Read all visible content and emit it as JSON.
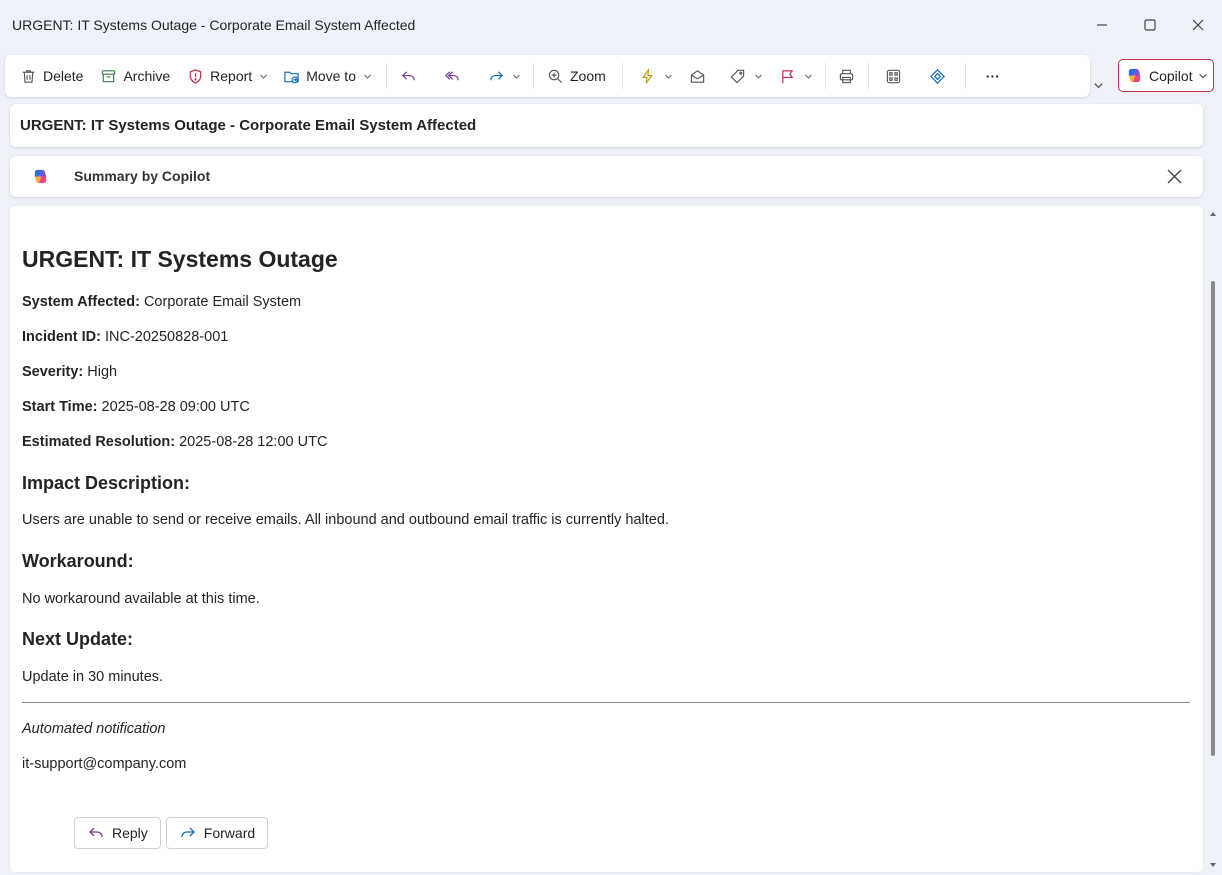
{
  "window": {
    "title": "URGENT: IT Systems Outage - Corporate Email System Affected"
  },
  "toolbar": {
    "delete_label": "Delete",
    "archive_label": "Archive",
    "report_label": "Report",
    "move_to_label": "Move to",
    "zoom_label": "Zoom",
    "copilot_label": "Copilot",
    "more_label": "···"
  },
  "subject": "URGENT: IT Systems Outage - Corporate Email System Affected",
  "summary": {
    "label": "Summary by Copilot"
  },
  "email": {
    "heading": "URGENT: IT Systems Outage",
    "fields": [
      {
        "label": "System Affected:",
        "value": "Corporate Email System"
      },
      {
        "label": "Incident ID:",
        "value": "INC-20250828-001"
      },
      {
        "label": "Severity:",
        "value": "High"
      },
      {
        "label": "Start Time:",
        "value": "2025-08-28 09:00 UTC"
      },
      {
        "label": "Estimated Resolution:",
        "value": "2025-08-28 12:00 UTC"
      }
    ],
    "impact_heading": "Impact Description:",
    "impact_text": "Users are unable to send or receive emails. All inbound and outbound email traffic is currently halted.",
    "workaround_heading": "Workaround:",
    "workaround_text": "No workaround available at this time.",
    "next_update_heading": "Next Update:",
    "next_update_text": "Update in 30 minutes.",
    "footer_note": "Automated notification",
    "footer_sender": "it-support@company.com"
  },
  "actions": {
    "reply_label": "Reply",
    "forward_label": "Forward"
  },
  "colors": {
    "accent_purple": "#7a3e9d",
    "report_red": "#c4314b",
    "flag_red": "#c4314b",
    "lightning_yellow": "#c19c00",
    "link_blue": "#0f6cbd"
  }
}
